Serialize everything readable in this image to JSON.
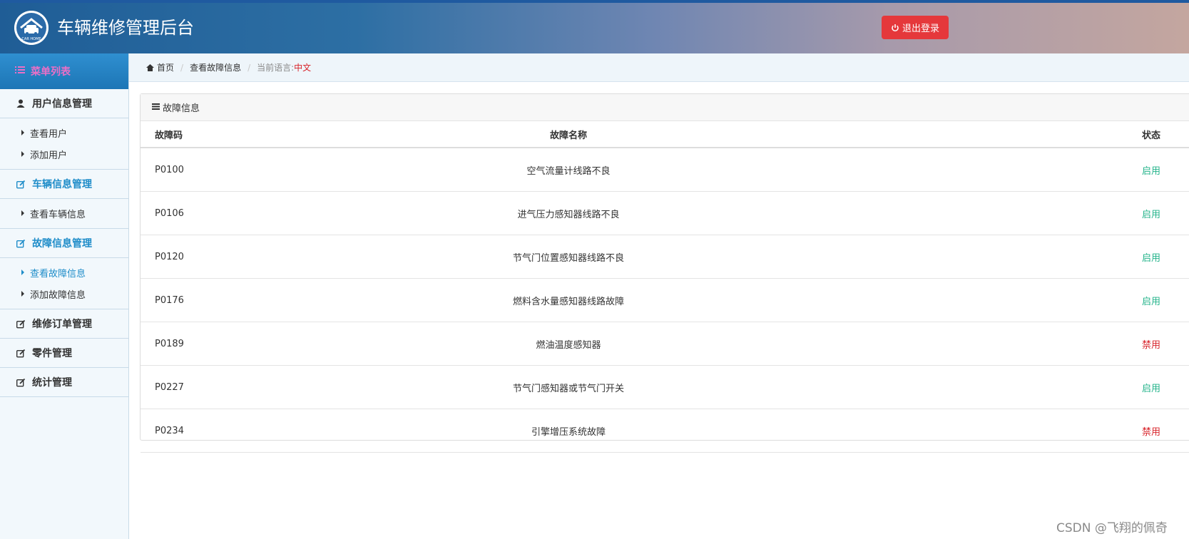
{
  "header": {
    "title": "车辆维修管理后台",
    "logo_text": "CAR HOME",
    "logout_label": "退出登录"
  },
  "sidebar": {
    "heading": "菜单列表",
    "groups": [
      {
        "label": "用户信息管理",
        "items": [
          "查看用户",
          "添加用户"
        ]
      },
      {
        "label": "车辆信息管理",
        "items": [
          "查看车辆信息"
        ]
      },
      {
        "label": "故障信息管理",
        "items": [
          "查看故障信息",
          "添加故障信息"
        ]
      },
      {
        "label": "维修订单管理",
        "items": []
      },
      {
        "label": "零件管理",
        "items": []
      },
      {
        "label": "统计管理",
        "items": []
      }
    ]
  },
  "breadcrumb": {
    "home": "首页",
    "current": "查看故障信息",
    "lang_prefix": "当前语言:",
    "lang_value": "中文"
  },
  "panel": {
    "title": "故障信息",
    "columns": [
      "故障码",
      "故障名称",
      "状态"
    ],
    "rows": [
      {
        "code": "P0100",
        "name": "空气流量计线路不良",
        "status": "启用"
      },
      {
        "code": "P0106",
        "name": "进气压力感知器线路不良",
        "status": "启用"
      },
      {
        "code": "P0120",
        "name": "节气门位置感知器线路不良",
        "status": "启用"
      },
      {
        "code": "P0176",
        "name": "燃料含水量感知器线路故障",
        "status": "启用"
      },
      {
        "code": "P0189",
        "name": "燃油温度感知器",
        "status": "禁用"
      },
      {
        "code": "P0227",
        "name": "节气门感知器或节气门开关",
        "status": "启用"
      },
      {
        "code": "P0234",
        "name": "引擎增压系统故障",
        "status": "禁用"
      }
    ]
  },
  "watermark": "CSDN @飞翔的佩奇",
  "colors": {
    "enabled": "#23b38a",
    "disabled": "#d8232a",
    "accent": "#1f8dc9"
  }
}
